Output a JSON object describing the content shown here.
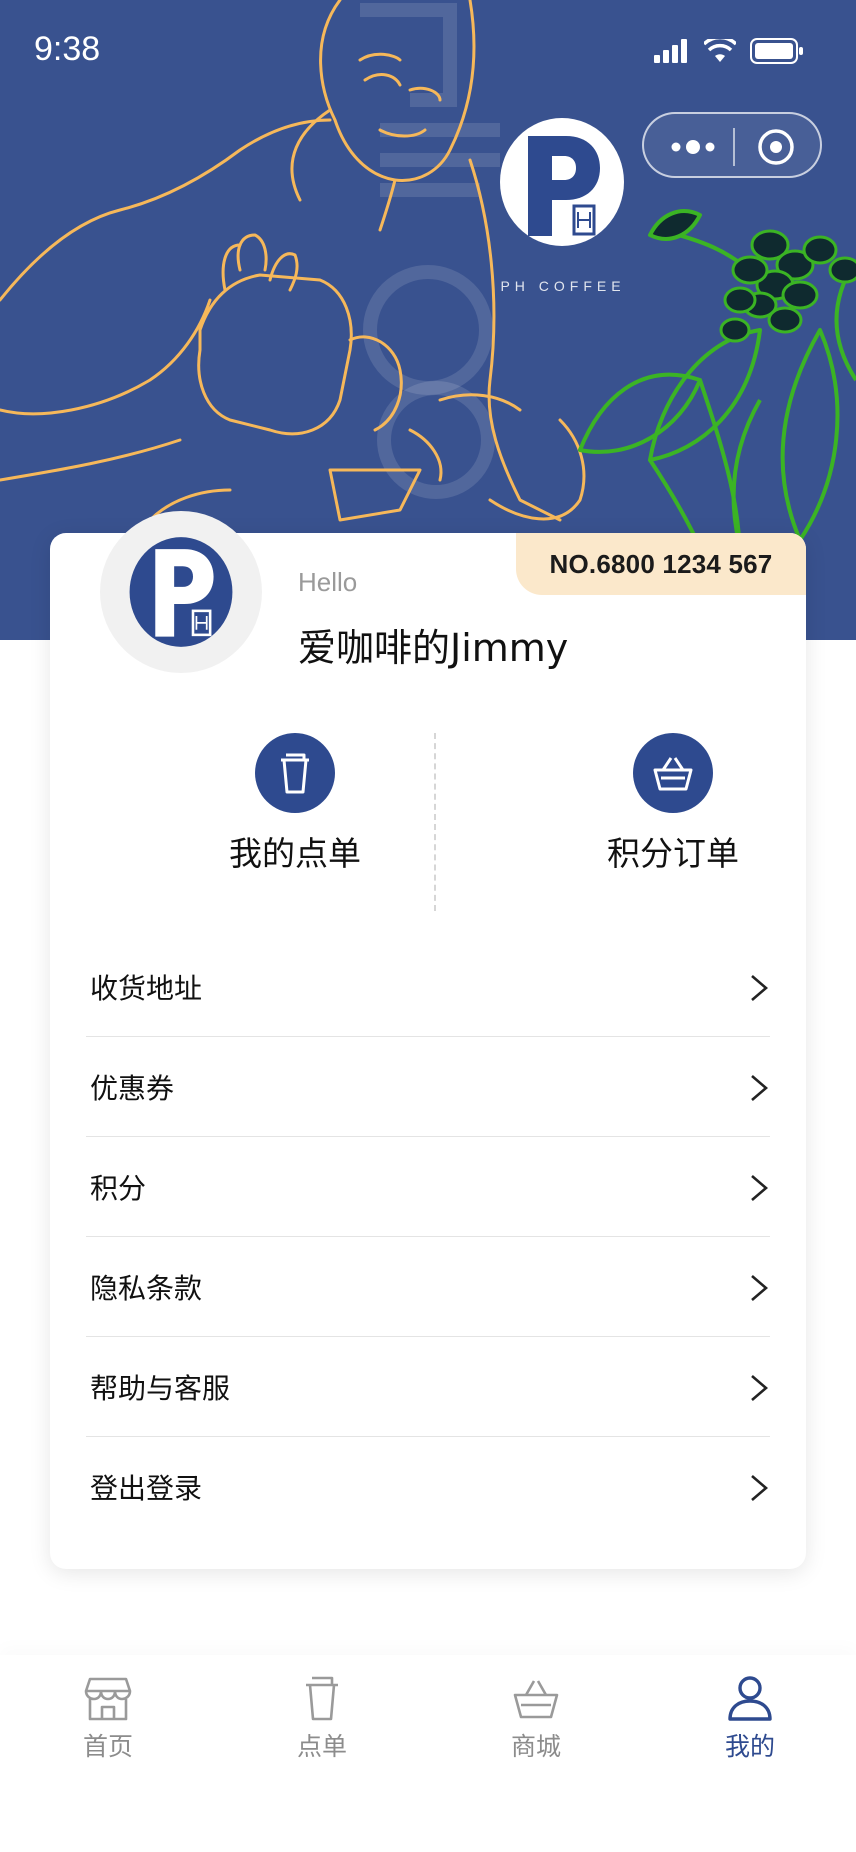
{
  "status_bar": {
    "time": "9:38"
  },
  "header": {
    "brand_name": "PH COFFEE",
    "background_color": "#39528f",
    "capsule_icons": [
      "more-dots-icon",
      "close-target-icon"
    ]
  },
  "profile": {
    "member_no": "NO.6800 1234 567",
    "greeting": "Hello",
    "username": "爱咖啡的Jimmy"
  },
  "quick_actions": [
    {
      "label": "我的点单",
      "icon": "cup-icon"
    },
    {
      "label": "积分订单",
      "icon": "basket-icon"
    }
  ],
  "menu": [
    {
      "label": "收货地址"
    },
    {
      "label": "优惠券"
    },
    {
      "label": "积分"
    },
    {
      "label": "隐私条款"
    },
    {
      "label": "帮助与客服"
    },
    {
      "label": "登出登录"
    }
  ],
  "tabbar": [
    {
      "label": "首页",
      "icon": "store-icon",
      "active": false
    },
    {
      "label": "点单",
      "icon": "cup-icon",
      "active": false
    },
    {
      "label": "商城",
      "icon": "basket-icon",
      "active": false
    },
    {
      "label": "我的",
      "icon": "person-icon",
      "active": true
    }
  ],
  "colors": {
    "accent": "#2e4a8f",
    "badge": "#fbe8cb",
    "line_art": "#f6b85a",
    "leaf": "#3bb424"
  }
}
